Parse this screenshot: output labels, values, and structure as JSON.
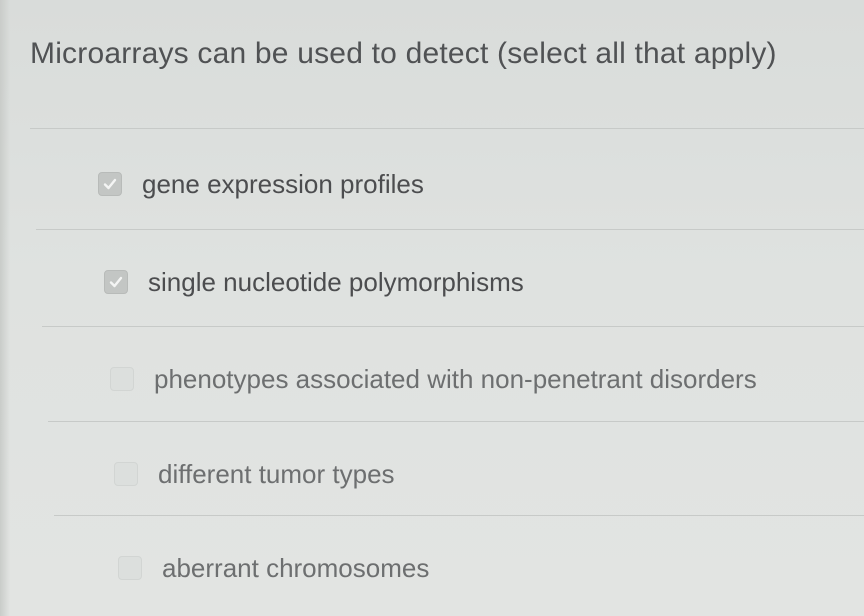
{
  "question": {
    "text": "Microarrays can be used to detect (select all that apply)"
  },
  "options": [
    {
      "label": "gene expression profiles",
      "checked": true
    },
    {
      "label": "single nucleotide polymorphisms",
      "checked": true
    },
    {
      "label": "phenotypes associated with non-penetrant disorders",
      "checked": false
    },
    {
      "label": "different tumor types",
      "checked": false
    },
    {
      "label": "aberrant chromosomes",
      "checked": false
    }
  ],
  "colors": {
    "background": "#dfe2e0",
    "text": "#4c4d4f",
    "checkbox_checked": "#c3c6c4",
    "checkmark": "#f4f5f4",
    "divider": "#c7cac8"
  },
  "icons": {
    "checked": "checkmark-icon"
  }
}
